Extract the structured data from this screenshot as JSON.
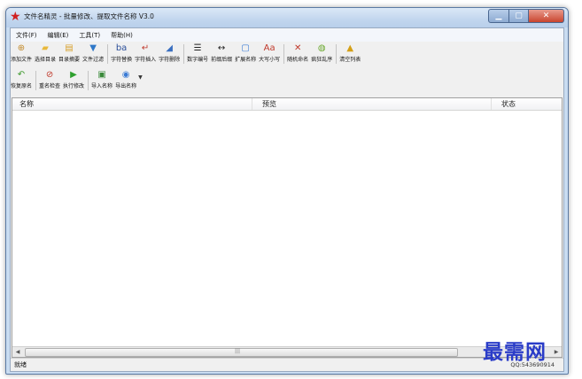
{
  "window": {
    "title": "文件名精灵 - 批量修改、提取文件名称 V3.0"
  },
  "menu": [
    {
      "label": "文件(F)"
    },
    {
      "label": "编辑(E)"
    },
    {
      "label": "工具(T)"
    },
    {
      "label": "帮助(H)"
    }
  ],
  "toolbar_row1": [
    {
      "label": "添加文件",
      "icon": "add-file-icon",
      "glyph": "⊕",
      "color": "#c28a2a"
    },
    {
      "label": "选择目录",
      "icon": "folder-icon",
      "glyph": "▰",
      "color": "#e8b83a"
    },
    {
      "label": "目录摘要",
      "icon": "folder-summary-icon",
      "glyph": "▤",
      "color": "#d8a12e"
    },
    {
      "label": "文件过滤",
      "icon": "filter-icon",
      "glyph": "▼",
      "color": "#2f78c8"
    },
    {
      "label": "字符替换",
      "icon": "replace-chars-icon",
      "glyph": "ba",
      "color": "#2b4f9a"
    },
    {
      "label": "字符插入",
      "icon": "insert-chars-icon",
      "glyph": "↵",
      "color": "#c0392b"
    },
    {
      "label": "字符删除",
      "icon": "delete-chars-icon",
      "glyph": "◢",
      "color": "#3a6fc0"
    },
    {
      "label": "数字编号",
      "icon": "numbering-icon",
      "glyph": "☰",
      "color": "#222222"
    },
    {
      "label": "前缀后缀",
      "icon": "prefix-suffix-icon",
      "glyph": "↔",
      "color": "#222222"
    },
    {
      "label": "扩展名称",
      "icon": "extension-icon",
      "glyph": "▢",
      "color": "#3a7bd5"
    },
    {
      "label": "大写小写",
      "icon": "case-icon",
      "glyph": "Aa",
      "color": "#c0392b"
    },
    {
      "label": "随机命名",
      "icon": "random-icon",
      "glyph": "✕",
      "color": "#c0392b"
    },
    {
      "label": "疯狂乱序",
      "icon": "shuffle-icon",
      "glyph": "◍",
      "color": "#6aa82e"
    },
    {
      "label": "清空列表",
      "icon": "clear-list-icon",
      "glyph": "▲",
      "color": "#d4a017"
    }
  ],
  "toolbar_row2": [
    {
      "label": "恢复原名",
      "icon": "restore-icon",
      "glyph": "↶",
      "color": "#3f9a2f"
    },
    {
      "label": "重名检查",
      "icon": "duplicate-check-icon",
      "glyph": "⊘",
      "color": "#c0392b"
    },
    {
      "label": "执行修改",
      "icon": "execute-icon",
      "glyph": "▶",
      "color": "#2fa02f"
    },
    {
      "label": "导入名称",
      "icon": "import-icon",
      "glyph": "▣",
      "color": "#3a8a3a"
    },
    {
      "label": "导出名称",
      "icon": "export-icon",
      "glyph": "◉",
      "color": "#3a7bd5"
    }
  ],
  "list": {
    "columns": [
      {
        "label": "名称"
      },
      {
        "label": "预览"
      },
      {
        "label": "状态"
      }
    ]
  },
  "statusbar": {
    "status": "就绪",
    "qq": "QQ:543690914"
  },
  "watermark": "最需网"
}
